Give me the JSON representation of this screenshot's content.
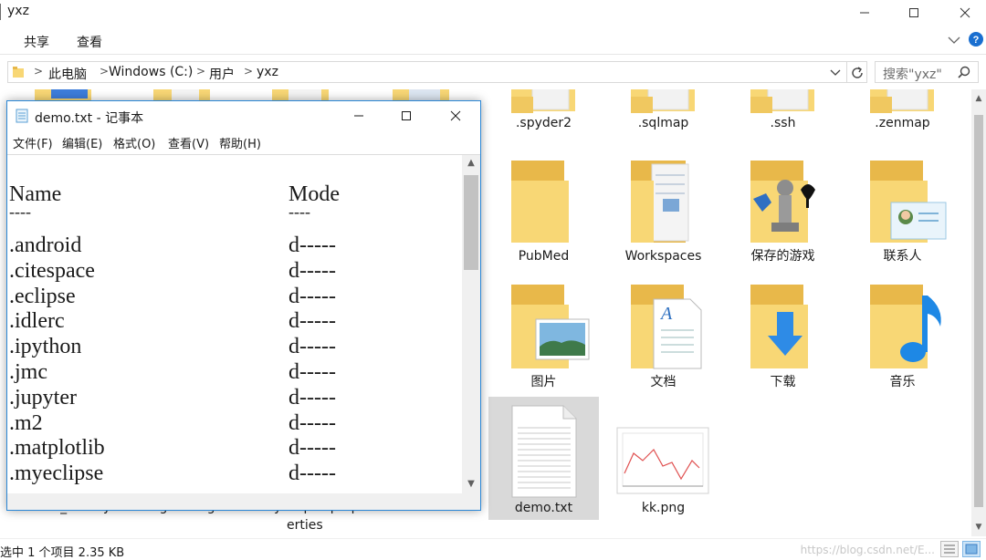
{
  "explorer": {
    "title": "yxz",
    "ribbon_tabs": [
      "共享",
      "查看"
    ],
    "breadcrumb": [
      "此电脑",
      "Windows (C:)",
      "用户",
      "yxz"
    ],
    "search_placeholder": "搜索\"yxz\"",
    "items": [
      {
        "label": ".spyder2",
        "icon": "folder-icon"
      },
      {
        "label": ".sqlmap",
        "icon": "folder-icon"
      },
      {
        "label": ".ssh",
        "icon": "folder-icon"
      },
      {
        "label": ".zenmap",
        "icon": "folder-icon"
      },
      {
        "label": "PubMed",
        "icon": "folder-icon"
      },
      {
        "label": "Workspaces",
        "icon": "folder-documents-icon"
      },
      {
        "label": "保存的游戏",
        "icon": "saved-games-icon"
      },
      {
        "label": "联系人",
        "icon": "contacts-icon"
      },
      {
        "label": "图片",
        "icon": "pictures-icon"
      },
      {
        "label": "文档",
        "icon": "documents-icon"
      },
      {
        "label": "下载",
        "icon": "downloads-icon"
      },
      {
        "label": "音乐",
        "icon": "music-icon"
      },
      {
        "label": "demo.txt",
        "icon": "text-file-icon"
      },
      {
        "label": "kk.png",
        "icon": "image-file-icon"
      }
    ],
    "behind_labels": [
      ".bash_history",
      ".gitconfig",
      ".myeclipse.properties",
      ".viminfo"
    ],
    "behind_label_lines": [
      "erties"
    ],
    "status": "选中 1 个项目  2.35 KB",
    "watermark": "https://blog.csdn.net/E..."
  },
  "notepad": {
    "title": "demo.txt - 记事本",
    "menu": [
      "文件(F)",
      "编辑(E)",
      "格式(O)",
      "查看(V)",
      "帮助(H)"
    ],
    "header": {
      "name": "Name",
      "mode": "Mode",
      "name_rule": "----",
      "mode_rule": "----"
    },
    "rows": [
      {
        "name": ".android",
        "mode": "d-----"
      },
      {
        "name": ".citespace",
        "mode": "d-----"
      },
      {
        "name": ".eclipse",
        "mode": "d-----"
      },
      {
        "name": ".idlerc",
        "mode": "d-----"
      },
      {
        "name": ".ipython",
        "mode": "d-----"
      },
      {
        "name": ".jmc",
        "mode": "d-----"
      },
      {
        "name": ".jupyter",
        "mode": "d-----"
      },
      {
        "name": ".m2",
        "mode": "d-----"
      },
      {
        "name": ".matplotlib",
        "mode": "d-----"
      },
      {
        "name": ".myeclipse",
        "mode": "d-----"
      }
    ]
  },
  "colors": {
    "folder": "#f8d775",
    "folder_dark": "#e8b84a",
    "accent": "#2b87d6",
    "selection": "#d9d9d9"
  }
}
